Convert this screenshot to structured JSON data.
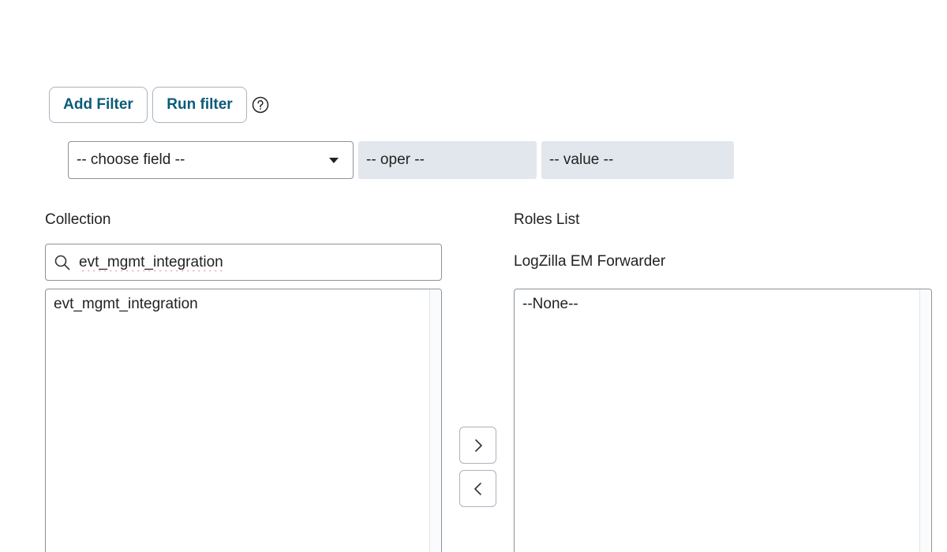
{
  "toolbar": {
    "add_filter_label": "Add Filter",
    "run_filter_label": "Run filter"
  },
  "filter": {
    "field_placeholder": "-- choose field --",
    "oper_placeholder": "-- oper --",
    "value_placeholder": "-- value --"
  },
  "collection": {
    "label": "Collection",
    "search_value": "evt_mgmt_integration",
    "items": [
      "evt_mgmt_integration"
    ]
  },
  "roles": {
    "label": "Roles List",
    "selected_role": "LogZilla EM Forwarder",
    "items": [
      "--None--"
    ]
  },
  "icons": {
    "help": "help-circle-icon",
    "search": "search-icon",
    "move_right": "chevron-right-icon",
    "move_left": "chevron-left-icon"
  },
  "colors": {
    "button_text": "#0b5a7a",
    "disabled_field_bg": "#e1e7ec"
  }
}
